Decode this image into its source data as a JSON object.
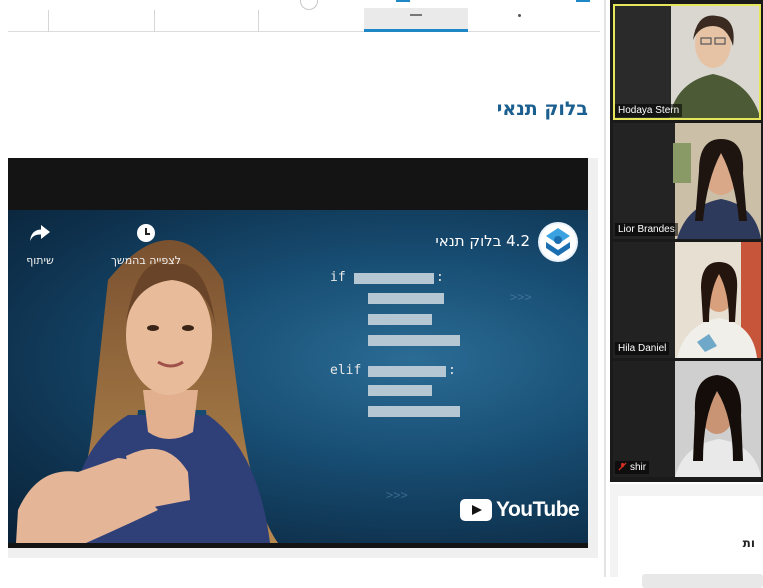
{
  "course": {
    "section_title": "בלוק תנאי"
  },
  "video": {
    "title": "4.2 בלוק תנאי",
    "share_label": "שיתוף",
    "watch_later_label": "לצפייה בהמשך",
    "code": {
      "if_keyword": "if",
      "elif_keyword": "elif",
      "colon": ":"
    },
    "youtube_wordmark": "YouTube",
    "icons": [
      "share-icon",
      "clock-icon",
      "channel-logo-icon",
      "youtube-play-icon"
    ]
  },
  "zoom": {
    "participants": [
      {
        "name": "Hodaya Stern",
        "muted": false,
        "active_speaker": true
      },
      {
        "name": "Lior Brandes",
        "muted": false,
        "active_speaker": false
      },
      {
        "name": "Hila Daniel",
        "muted": false,
        "active_speaker": false
      },
      {
        "name": "shir",
        "muted": true,
        "active_speaker": false
      }
    ]
  },
  "side_panel": {
    "heading_fragment": "ות"
  },
  "colors": {
    "accent": "#1e88c7",
    "title_blue": "#1a5f8f",
    "video_bg": "#184e74",
    "active_speaker_border": "#e6e65a",
    "mute_red": "#d93025"
  }
}
